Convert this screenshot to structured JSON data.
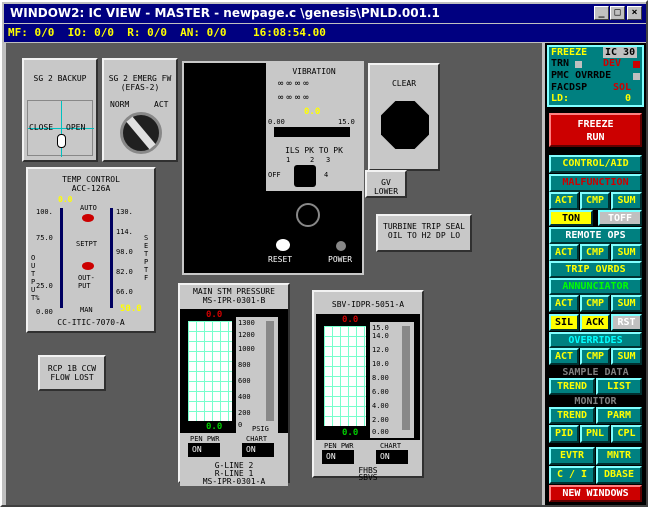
{
  "window": {
    "title": "WINDOW2:  IC VIEW - MASTER - newpage.c \\genesis\\PNLD.001.1",
    "min": "_",
    "max": "□",
    "close": "×"
  },
  "status": {
    "text": "MF: 0/0  IO: 0/0  R: 0/0  AN: 0/0    16:08:54.00"
  },
  "sg2backup": {
    "title": "SG 2 BACKUP",
    "close": "CLOSE",
    "open": "OPEN"
  },
  "sg2emerg": {
    "title": "SG 2 EMERG FW (EFAS-2)",
    "norm": "NORM",
    "act": "ACT"
  },
  "vibration": {
    "title": "VIBRATION",
    "scale_lo": "0.00",
    "scale_hi": "15.0",
    "value": "0.0",
    "mode": "ILS PK TO PK",
    "pos1": "1",
    "pos2": "2",
    "pos3": "3",
    "off": "OFF",
    "pos4": "4",
    "reset": "RESET",
    "power": "POWER"
  },
  "clear": {
    "label": "CLEAR"
  },
  "gvlower": {
    "label": "GV LOWER"
  },
  "turbine": {
    "label": "TURBINE TRIP SEAL OIL TO H2 DP LO"
  },
  "tempctrl": {
    "title": "TEMP CONTROL",
    "subtitle": "ACC-126A",
    "value": "0.0",
    "auto": "AUTO",
    "setpt": "SETPT",
    "output": "OUT-PUT",
    "man": "MAN",
    "l100": "100.",
    "l75": "75.0",
    "l25": "25.0",
    "l0": "0.00",
    "r130": "130.",
    "r114": "114.",
    "r98": "98.0",
    "r82": "82.0",
    "r66": "66.0",
    "r50": "50.0",
    "yl": "OUTPUT%",
    "yr": "SET PT F",
    "reading": "50.0",
    "tag": "CC-ITIC-7070-A"
  },
  "rcp": {
    "label": "RCP 1B CCW FLOW LOST"
  },
  "mainstm": {
    "title": "MAIN STM PRESSURE",
    "tag": "MS-IPR-0301-B",
    "top": "0.0",
    "bot": "0.0",
    "s1300": "1300",
    "s1200": "1200",
    "s1000": "1000",
    "s800": "800",
    "s600": "600",
    "s400": "400",
    "s200": "200",
    "s0": "0",
    "unit": "PSIG",
    "penpwr": "PEN PWR",
    "chart": "CHART",
    "on1": "ON",
    "on2": "ON",
    "foot1": "G-LINE 2",
    "foot2": "R-LINE 1",
    "foot3": "MS-IPR-0301-A"
  },
  "sbv": {
    "title": "SBV-IDPR-5051-A",
    "top": "0.0",
    "bot": "0.0",
    "s15": "15.0",
    "s14": "14.0",
    "s12": "12.0",
    "s10": "10.0",
    "s8": "8.00",
    "s6": "6.00",
    "s4": "4.00",
    "s2": "2.00",
    "s0": "0.00",
    "penpwr": "PEN PWR",
    "chart": "CHART",
    "on1": "ON",
    "on2": "ON",
    "foot1": "FHBS",
    "foot2": "SBVS"
  },
  "sidebar": {
    "freeze": "FREEZE",
    "ic": "IC 30",
    "trn": "TRN",
    "dev": "DEV",
    "pmc": "PMC OVRRDE",
    "facdsp": "FACDSP",
    "sol": "SOL",
    "ld": "LD:",
    "ldval": "0",
    "freezerun1": "FREEZE",
    "freezerun2": "RUN",
    "controlaid": "CONTROL/AID",
    "malfunction": "MALFUNCTION",
    "act": "ACT",
    "cmp": "CMP",
    "sum": "SUM",
    "ton": "TON",
    "toff": "TOFF",
    "remoteops": "REMOTE OPS",
    "tripovrds": "TRIP OVRDS",
    "annunciator": "ANNUNCIATOR",
    "sil": "SIL",
    "ack": "ACK",
    "rst": "RST",
    "overrides": "OVERRIDES",
    "sampledata": "SAMPLE DATA",
    "trend": "TREND",
    "list": "LIST",
    "monitor": "MONITOR",
    "parm": "PARM",
    "pid": "PID",
    "pnl": "PNL",
    "cpl": "CPL",
    "evtr": "EVTR",
    "mntr": "MNTR",
    "ci": "C / I",
    "dbase": "DBASE",
    "newwindows": "NEW WINDOWS"
  },
  "colors": {
    "title_bg": "#000080",
    "accent": "#008080",
    "alarm": "#cc0000",
    "value_yellow": "#ffff00",
    "value_green": "#00cc00"
  }
}
